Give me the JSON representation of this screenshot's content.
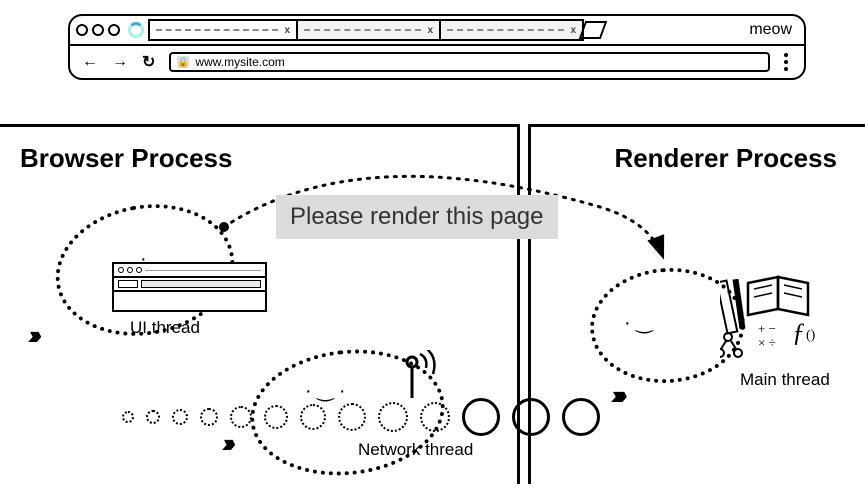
{
  "browser_chrome": {
    "brand": "meow",
    "url": "www.mysite.com",
    "tabs": [
      {
        "close": "x"
      },
      {
        "close": "x"
      },
      {
        "close": "x"
      }
    ]
  },
  "processes": {
    "browser": {
      "title": "Browser Process"
    },
    "renderer": {
      "title": "Renderer Process"
    }
  },
  "threads": {
    "ui": {
      "label": "UI thread"
    },
    "network": {
      "label": "Network thread"
    },
    "main": {
      "label": "Main thread"
    }
  },
  "message": {
    "text": "Please render this page"
  },
  "main_thread_tools": {
    "math_symbols": "+ −\n× ÷",
    "fn": "{()"
  }
}
